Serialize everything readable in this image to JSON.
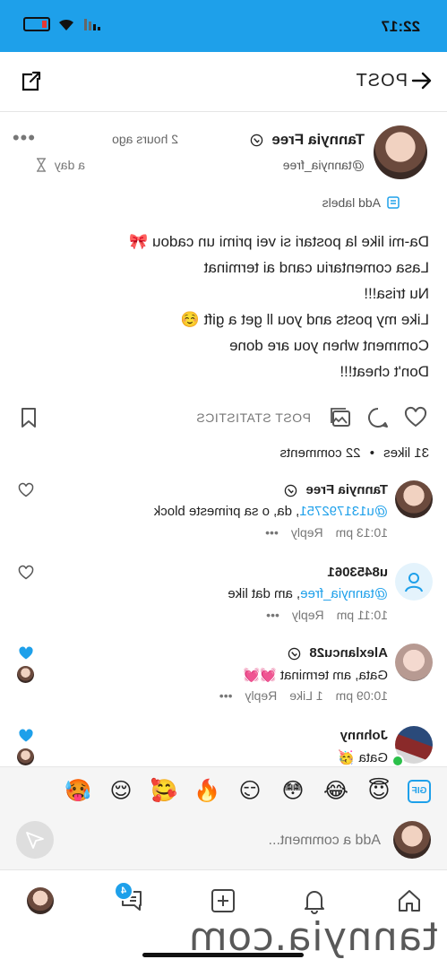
{
  "status_bar": {
    "time": "22:17"
  },
  "topbar": {
    "title": "POST"
  },
  "post": {
    "author_name": "Tannyia Free",
    "author_handle": "@tannyia_free",
    "time_ago": "2 hours ago",
    "more": "•••",
    "expires": "a day",
    "add_labels": "Add labels",
    "text_lines": [
      "Da-mi like la postari si vei primi un cadou 🎀",
      "Lasa comentariu cand ai terminat",
      "Nu trisa!!!",
      "Like my posts and you ll get a gift ☺️",
      "Comment when you are done",
      "Don't cheat!!!"
    ],
    "stats_label": "POST STATISTICS",
    "likes": "31 likes",
    "separator": "•",
    "comments": "22 comments"
  },
  "comments": [
    {
      "name": "Tannyia Free",
      "mention": "@u131792751",
      "text": ", da, o sa primeste block",
      "time": "10:13 pm",
      "likes": "",
      "reply": "Reply",
      "more": "•••"
    },
    {
      "name": "u8453061",
      "mention": "@tannyia_free",
      "text": ", am dat like",
      "time": "10:11 pm",
      "likes": "",
      "reply": "Reply",
      "more": "•••"
    },
    {
      "name": "Alexlancu28",
      "mention": "",
      "text": "Gata, am terminat 💓💓",
      "time": "10:09 pm",
      "likes": "1 Like",
      "reply": "Reply",
      "more": "•••"
    },
    {
      "name": "Johnny",
      "mention": "",
      "text": "Gata 🥳",
      "time": "",
      "likes": "",
      "reply": "",
      "more": ""
    }
  ],
  "composer": {
    "gif": "GIF",
    "emojis": [
      "😇",
      "😂",
      "😳",
      "😏",
      "🔥",
      "🥰",
      "😌",
      "🥵"
    ],
    "placeholder": "Add a comment..."
  },
  "nav": {
    "badge": "4"
  },
  "watermark": "tannyia.com",
  "colors": {
    "accent": "#1ea0ea",
    "like_filled": "#1ea0ea"
  }
}
